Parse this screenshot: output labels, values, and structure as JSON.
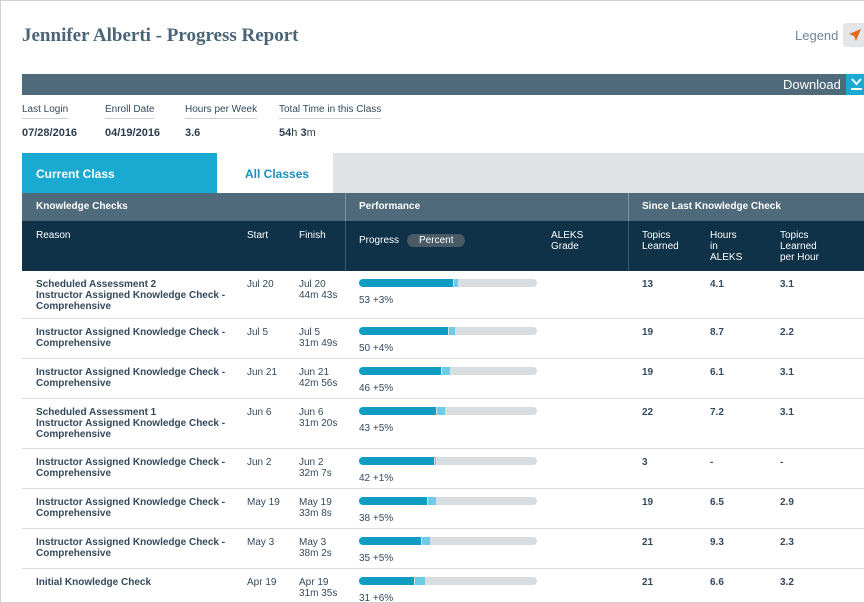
{
  "header": {
    "title": "Jennifer Alberti - Progress Report",
    "legend_label": "Legend",
    "legend_icon": "paper-plane-icon",
    "download_label": "Download",
    "download_icon": "download-icon"
  },
  "stats": [
    {
      "label": "Last Login",
      "value": "07/28/2016"
    },
    {
      "label": "Enroll Date",
      "value": "04/19/2016"
    },
    {
      "label": "Hours per Week",
      "value": "3.6"
    },
    {
      "label": "Total Time in this Class",
      "value_hours": "54",
      "value_h_unit": "h",
      "value_minutes": "3",
      "value_m_unit": "m"
    }
  ],
  "tabs": [
    {
      "label": "Current Class",
      "active": true
    },
    {
      "label": "All Classes",
      "active": false
    }
  ],
  "groups": {
    "knowledge_checks": "Knowledge Checks",
    "performance": "Performance",
    "since_last": "Since Last Knowledge Check"
  },
  "columns": {
    "reason": "Reason",
    "start": "Start",
    "finish": "Finish",
    "progress": "Progress",
    "percent": "Percent",
    "aleks_grade_1": "ALEKS",
    "aleks_grade_2": "Grade",
    "topics_learned_1": "Topics",
    "topics_learned_2": "Learned",
    "hours_1": "Hours",
    "hours_2": "in",
    "hours_3": "ALEKS",
    "tlph_1": "Topics",
    "tlph_2": "Learned",
    "tlph_3": "per Hour"
  },
  "colors": {
    "accent": "#1aa9d1",
    "header_dark": "#0f3248",
    "group_bar": "#4f6a7b",
    "progress_fill": "#119cc4",
    "progress_gain": "#6fcce6"
  },
  "rows": [
    {
      "reason": [
        "Scheduled Assessment 2",
        "Instructor Assigned Knowledge Check -",
        "Comprehensive"
      ],
      "start": "Jul 20",
      "finish": [
        "Jul 20",
        "44m 43s"
      ],
      "progress_base": 53,
      "progress_gain": 3,
      "progress_text": "53 +3%",
      "topics": "13",
      "hours": "4.1",
      "per_hour": "3.1"
    },
    {
      "reason": [
        "Instructor Assigned Knowledge Check -",
        "Comprehensive"
      ],
      "start": "Jul 5",
      "finish": [
        "Jul 5",
        "31m 49s"
      ],
      "progress_base": 50,
      "progress_gain": 4,
      "progress_text": "50 +4%",
      "topics": "19",
      "hours": "8.7",
      "per_hour": "2.2"
    },
    {
      "reason": [
        "Instructor Assigned Knowledge Check -",
        "Comprehensive"
      ],
      "start": "Jun 21",
      "finish": [
        "Jun 21",
        "42m 56s"
      ],
      "progress_base": 46,
      "progress_gain": 5,
      "progress_text": "46 +5%",
      "topics": "19",
      "hours": "6.1",
      "per_hour": "3.1"
    },
    {
      "reason": [
        "Scheduled Assessment 1",
        "Instructor Assigned Knowledge Check -",
        "Comprehensive"
      ],
      "start": "Jun 6",
      "finish": [
        "Jun 6",
        "31m 20s"
      ],
      "progress_base": 43,
      "progress_gain": 5,
      "progress_text": "43 +5%",
      "topics": "22",
      "hours": "7.2",
      "per_hour": "3.1"
    },
    {
      "reason": [
        "Instructor Assigned Knowledge Check -",
        "Comprehensive"
      ],
      "start": "Jun 2",
      "finish": [
        "Jun 2",
        "32m 7s"
      ],
      "progress_base": 42,
      "progress_gain": 1,
      "progress_text": "42 +1%",
      "topics": "3",
      "hours": "-",
      "per_hour": "-"
    },
    {
      "reason": [
        "Instructor Assigned Knowledge Check -",
        "Comprehensive"
      ],
      "start": "May 19",
      "finish": [
        "May 19",
        "33m 8s"
      ],
      "progress_base": 38,
      "progress_gain": 5,
      "progress_text": "38 +5%",
      "topics": "19",
      "hours": "6.5",
      "per_hour": "2.9"
    },
    {
      "reason": [
        "Instructor Assigned Knowledge Check -",
        "Comprehensive"
      ],
      "start": "May 3",
      "finish": [
        "May 3",
        "38m 2s"
      ],
      "progress_base": 35,
      "progress_gain": 5,
      "progress_text": "35 +5%",
      "topics": "21",
      "hours": "9.3",
      "per_hour": "2.3"
    },
    {
      "reason": [
        "Initial Knowledge Check"
      ],
      "start": "Apr 19",
      "finish": [
        "Apr 19",
        "31m 35s"
      ],
      "progress_base": 31,
      "progress_gain": 6,
      "progress_text": "31 +6%",
      "topics": "21",
      "hours": "6.6",
      "per_hour": "3.2"
    }
  ]
}
